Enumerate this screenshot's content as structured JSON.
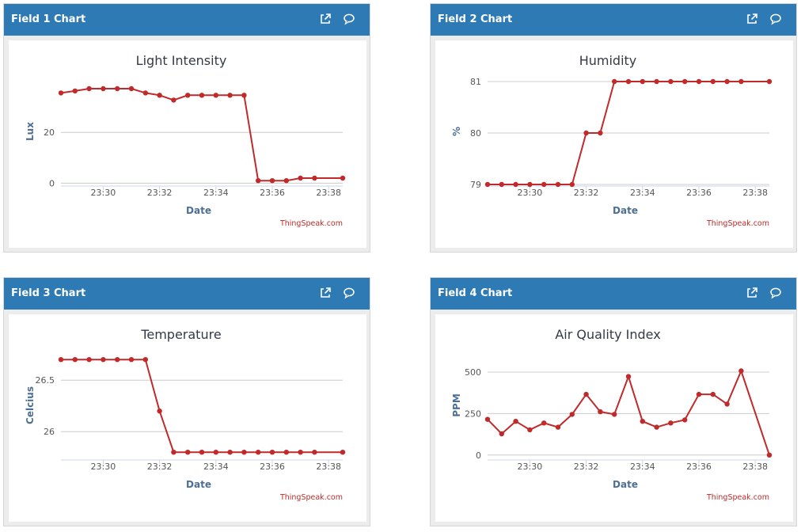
{
  "panels": [
    {
      "header": "Field 1 Chart",
      "chart_data": {
        "type": "line",
        "title": "Light Intensity",
        "xlabel": "Date",
        "ylabel": "Lux",
        "credit": "ThingSpeak.com",
        "color": "#c02a2a",
        "x_range": [
          "23:28:30",
          "23:38:30"
        ],
        "x_ticks": [
          "23:30",
          "23:32",
          "23:34",
          "23:36",
          "23:38"
        ],
        "y_ticks": [
          0,
          20
        ],
        "ylim": [
          -0.5,
          40
        ],
        "grid": true,
        "legend": "none",
        "series": [
          {
            "x": [
              "23:28:30",
              "23:29:00",
              "23:29:30",
              "23:30:00",
              "23:30:30",
              "23:31:00",
              "23:31:30",
              "23:32:00",
              "23:32:30",
              "23:33:00",
              "23:33:30",
              "23:34:00",
              "23:34:30",
              "23:35:00",
              "23:35:30",
              "23:36:00",
              "23:36:30",
              "23:37:00",
              "23:37:30",
              "23:38:30"
            ],
            "y": [
              35.5,
              36.3,
              37.2,
              37.2,
              37.2,
              37.2,
              35.5,
              34.6,
              32.7,
              34.6,
              34.6,
              34.6,
              34.6,
              34.6,
              1.0,
              1.0,
              1.0,
              2.0,
              2.0,
              2.0
            ]
          }
        ]
      }
    },
    {
      "header": "Field 2 Chart",
      "chart_data": {
        "type": "line",
        "title": "Humidity",
        "xlabel": "Date",
        "ylabel": "%",
        "credit": "ThingSpeak.com",
        "color": "#c02a2a",
        "x_range": [
          "23:28:30",
          "23:38:30"
        ],
        "x_ticks": [
          "23:30",
          "23:32",
          "23:34",
          "23:36",
          "23:38"
        ],
        "y_ticks": [
          79,
          80,
          81
        ],
        "ylim": [
          79,
          81
        ],
        "grid": true,
        "legend": "none",
        "series": [
          {
            "x": [
              "23:28:30",
              "23:29:00",
              "23:29:30",
              "23:30:00",
              "23:30:30",
              "23:31:00",
              "23:31:30",
              "23:32:00",
              "23:32:30",
              "23:33:00",
              "23:33:30",
              "23:34:00",
              "23:34:30",
              "23:35:00",
              "23:35:30",
              "23:36:00",
              "23:36:30",
              "23:37:00",
              "23:37:30",
              "23:38:30"
            ],
            "y": [
              79,
              79,
              79,
              79,
              79,
              79,
              79,
              80,
              80,
              81,
              81,
              81,
              81,
              81,
              81,
              81,
              81,
              81,
              81,
              81
            ]
          }
        ]
      }
    },
    {
      "header": "Field 3 Chart",
      "chart_data": {
        "type": "line",
        "title": "Temperature",
        "xlabel": "Date",
        "ylabel": "Celcius",
        "credit": "ThingSpeak.com",
        "color": "#c02a2a",
        "x_range": [
          "23:28:30",
          "23:38:30"
        ],
        "x_ticks": [
          "23:30",
          "23:32",
          "23:34",
          "23:36",
          "23:38"
        ],
        "y_ticks": [
          26,
          26.5
        ],
        "ylim": [
          25.74,
          26.74
        ],
        "grid": true,
        "legend": "none",
        "series": [
          {
            "x": [
              "23:28:30",
              "23:29:00",
              "23:29:30",
              "23:30:00",
              "23:30:30",
              "23:31:00",
              "23:31:30",
              "23:32:00",
              "23:32:30",
              "23:33:00",
              "23:33:30",
              "23:34:00",
              "23:34:30",
              "23:35:00",
              "23:35:30",
              "23:36:00",
              "23:36:30",
              "23:37:00",
              "23:37:30",
              "23:38:30"
            ],
            "y": [
              26.7,
              26.7,
              26.7,
              26.7,
              26.7,
              26.7,
              26.7,
              26.2,
              25.8,
              25.8,
              25.8,
              25.8,
              25.8,
              25.8,
              25.8,
              25.8,
              25.8,
              25.8,
              25.8,
              25.8
            ]
          }
        ]
      }
    },
    {
      "header": "Field 4 Chart",
      "chart_data": {
        "type": "line",
        "title": "Air Quality Index",
        "xlabel": "Date",
        "ylabel": "PPM",
        "credit": "ThingSpeak.com",
        "color": "#c02a2a",
        "x_range": [
          "23:28:30",
          "23:38:30"
        ],
        "x_ticks": [
          "23:30",
          "23:32",
          "23:34",
          "23:36",
          "23:38"
        ],
        "y_ticks": [
          0,
          250,
          500
        ],
        "ylim": [
          -20,
          600
        ],
        "grid": true,
        "legend": "none",
        "series": [
          {
            "x": [
              "23:28:30",
              "23:29:00",
              "23:29:30",
              "23:30:00",
              "23:30:30",
              "23:31:00",
              "23:31:30",
              "23:32:00",
              "23:32:30",
              "23:33:00",
              "23:33:30",
              "23:34:00",
              "23:34:30",
              "23:35:00",
              "23:35:30",
              "23:36:00",
              "23:36:30",
              "23:37:00",
              "23:37:30",
              "23:38:30"
            ],
            "y": [
              215,
              128,
              203,
              152,
              193,
              168,
              245,
              366,
              261,
              245,
              473,
              203,
              168,
              193,
              212,
              366,
              366,
              307,
              507,
              0
            ]
          }
        ]
      }
    }
  ],
  "icons": {
    "popout": "external-link-icon",
    "comment": "comment-icon"
  }
}
